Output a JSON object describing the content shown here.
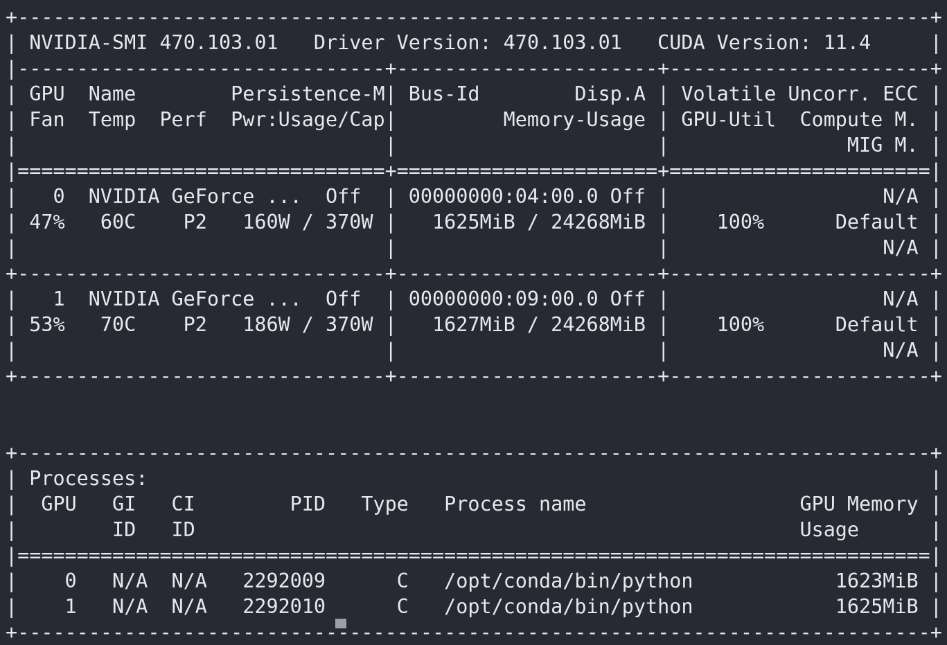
{
  "terminal": {
    "lines": [
      "+-----------------------------------------------------------------------------+",
      "| NVIDIA-SMI 470.103.01   Driver Version: 470.103.01   CUDA Version: 11.4     |",
      "|-------------------------------+----------------------+----------------------+",
      "| GPU  Name        Persistence-M| Bus-Id        Disp.A | Volatile Uncorr. ECC |",
      "| Fan  Temp  Perf  Pwr:Usage/Cap|         Memory-Usage | GPU-Util  Compute M. |",
      "|                               |                      |               MIG M. |",
      "|===============================+======================+======================|",
      "|   0  NVIDIA GeForce ...  Off  | 00000000:04:00.0 Off |                  N/A |",
      "| 47%   60C    P2   160W / 370W |   1625MiB / 24268MiB |    100%      Default |",
      "|                               |                      |                  N/A |",
      "+-------------------------------+----------------------+----------------------+",
      "|   1  NVIDIA GeForce ...  Off  | 00000000:09:00.0 Off |                  N/A |",
      "| 53%   70C    P2   186W / 370W |   1627MiB / 24268MiB |    100%      Default |",
      "|                               |                      |                  N/A |",
      "+-------------------------------+----------------------+----------------------+",
      "",
      "",
      "+-----------------------------------------------------------------------------+",
      "| Processes:                                                                  |",
      "|  GPU   GI   CI        PID   Type   Process name                  GPU Memory |",
      "|        ID   ID                                                   Usage      |",
      "|=============================================================================|",
      "|    0   N/A  N/A   2292009      C   /opt/conda/bin/python            1623MiB |",
      "|    1   N/A  N/A   2292010      C   /opt/conda/bin/python            1625MiB |",
      "+-----------------------------------------------------------------------------+"
    ]
  }
}
